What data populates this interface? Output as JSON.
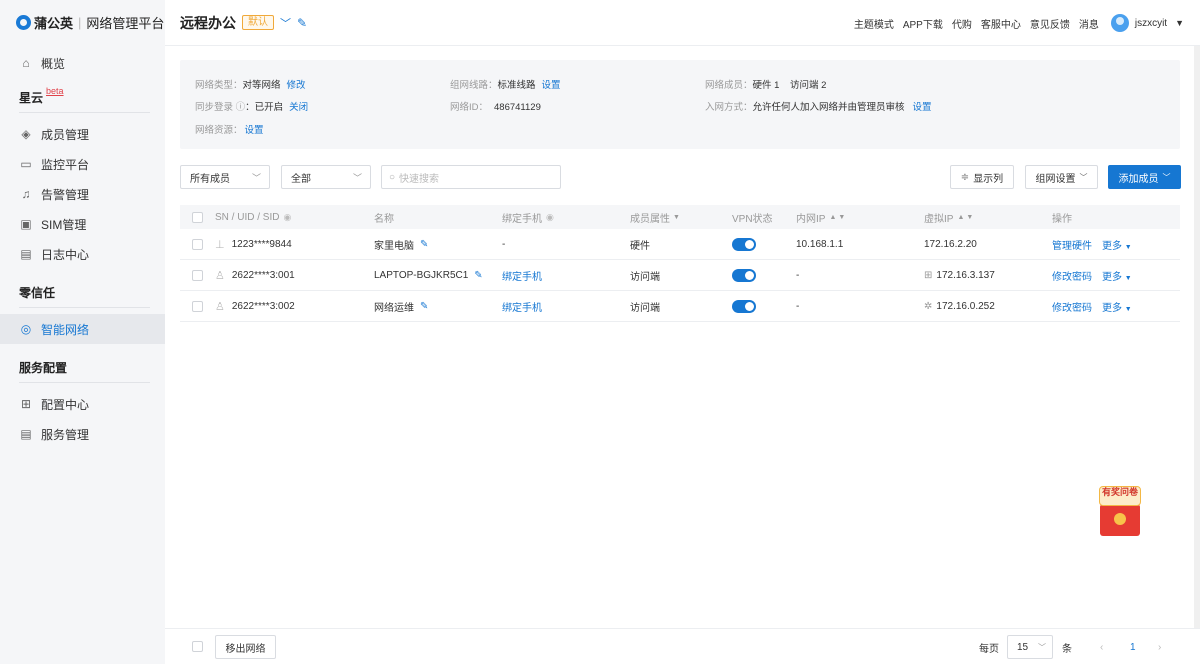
{
  "brand": {
    "name": "蒲公英",
    "separator": "|",
    "subtitle": "网络管理平台"
  },
  "sidebar": {
    "overview": "概览",
    "sections": {
      "xingyun": "星云",
      "xingyun_badge": "beta",
      "zero_trust": "零信任",
      "service_config": "服务配置"
    },
    "items": {
      "member_mgmt": "成员管理",
      "monitor": "监控平台",
      "alert": "告警管理",
      "sim": "SIM管理",
      "log": "日志中心",
      "smart_network": "智能网络",
      "config_center": "配置中心",
      "service_mgmt": "服务管理"
    }
  },
  "header": {
    "network_name": "远程办公",
    "default_badge": "默认",
    "links": [
      "主题模式",
      "APP下载",
      "代购",
      "客服中心",
      "意见反馈",
      "消息"
    ],
    "username": "jszxcyit"
  },
  "info": {
    "network_type_label": "网络类型：",
    "network_type_value": "对等网络",
    "network_type_action": "修改",
    "sync_login_label": "同步登录",
    "sync_login_value": "：已开启",
    "sync_login_action": "关闭",
    "network_resource_label": "网络资源：",
    "network_resource_action": "设置",
    "route_label": "组网线路：",
    "route_value": "标准线路",
    "route_action": "设置",
    "network_id_label": "网络ID：",
    "network_id_value": "486741129",
    "members_label": "网络成员：",
    "members_value": "硬件 1    访问端 2",
    "join_label": "入网方式：",
    "join_value": "允许任何人加入网络并由管理员审核",
    "join_action": "设置"
  },
  "filters": {
    "member_select": "所有成员",
    "status_select": "全部",
    "search_placeholder": "快速搜索",
    "display_columns": "显示列",
    "network_settings": "组网设置",
    "add_member": "添加成员"
  },
  "table": {
    "headers": {
      "id": "SN / UID / SID",
      "name": "名称",
      "phone": "绑定手机",
      "attr": "成员属性",
      "vpn": "VPN状态",
      "lan_ip": "内网IP",
      "virtual_ip": "虚拟IP",
      "ops": "操作"
    },
    "rows": [
      {
        "id": "1223****9844",
        "name": "家里电脑",
        "phone": "-",
        "attr": "硬件",
        "lan_ip": "10.168.1.1",
        "virtual_ip": "172.16.2.20",
        "op1": "管理硬件",
        "op2": "更多",
        "device_icon": "router-icon",
        "os_icon": ""
      },
      {
        "id": "2622****3:001",
        "name": "LAPTOP-BGJKR5C1",
        "phone": "绑定手机",
        "attr": "访问端",
        "lan_ip": "-",
        "virtual_ip": "172.16.3.137",
        "op1": "修改密码",
        "op2": "更多",
        "device_icon": "user-icon",
        "os_icon": "windows-icon"
      },
      {
        "id": "2622****3:002",
        "name": "网络运维",
        "phone": "绑定手机",
        "attr": "访问端",
        "lan_ip": "-",
        "virtual_ip": "172.16.0.252",
        "op1": "修改密码",
        "op2": "更多",
        "device_icon": "user-icon",
        "os_icon": "android-icon"
      }
    ]
  },
  "footer": {
    "remove": "移出网络",
    "per_page_label": "每页",
    "per_page_value": "15",
    "unit": "条",
    "current_page": "1"
  },
  "promo": {
    "text": "有奖问卷"
  }
}
